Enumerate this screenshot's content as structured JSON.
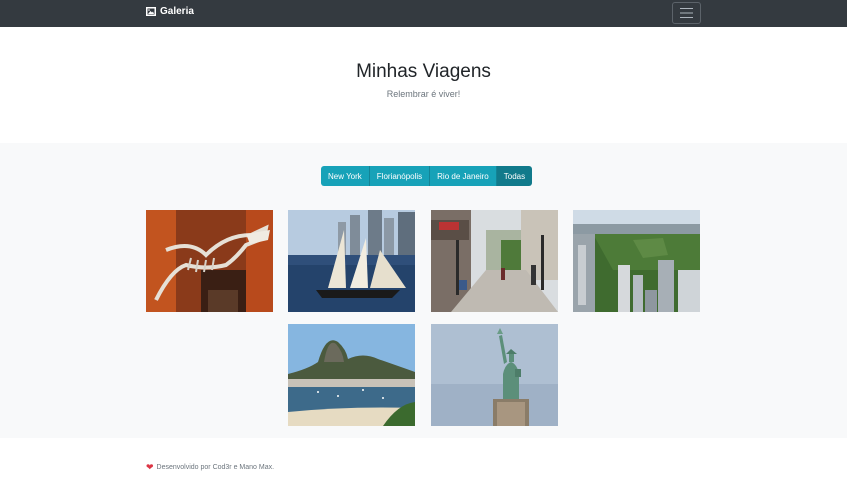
{
  "navbar": {
    "brand_label": "Galeria",
    "brand_icon": "image-icon",
    "toggler_icon": "hamburger-icon"
  },
  "hero": {
    "title": "Minhas Viagens",
    "subtitle": "Relembrar é viver!"
  },
  "filters": [
    {
      "label": "New York",
      "active": false
    },
    {
      "label": "Florianópolis",
      "active": false
    },
    {
      "label": "Rio de Janeiro",
      "active": false
    },
    {
      "label": "Todas",
      "active": true
    }
  ],
  "photos": [
    {
      "subject": "dinosaur-skeleton-museum"
    },
    {
      "subject": "sailboat-harbor"
    },
    {
      "subject": "pedestrian-street"
    },
    {
      "subject": "central-park-aerial"
    },
    {
      "subject": "sugarloaf-mountain-bay"
    },
    {
      "subject": "statue-of-liberty"
    }
  ],
  "footer": {
    "icon": "heart-icon",
    "text": "Desenvolvido por Cod3r e Mano Max."
  },
  "colors": {
    "navbar": "#343a40",
    "accent": "#17a2b8",
    "accent_active": "#117a8b",
    "gallery_bg": "#f8f9fa",
    "heart": "#dc3545"
  }
}
